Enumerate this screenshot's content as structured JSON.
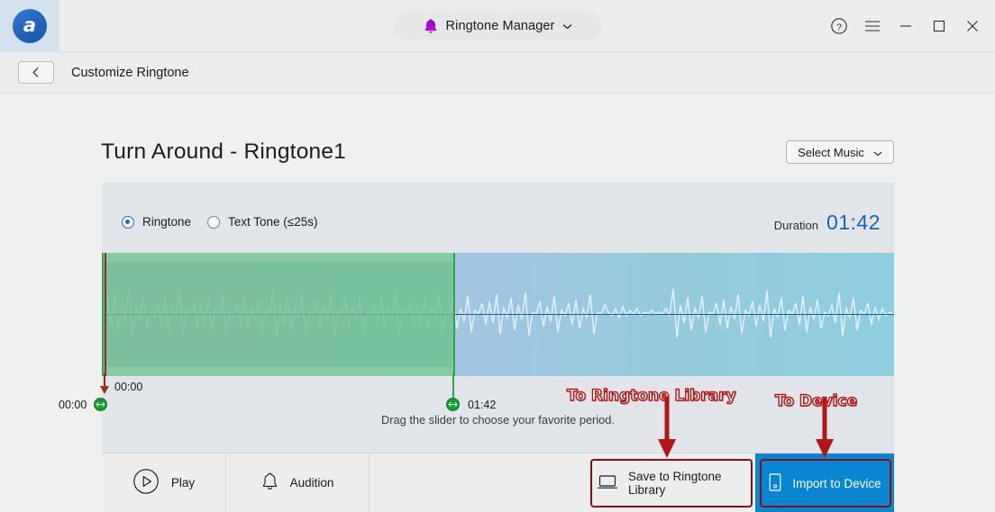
{
  "titlebar": {
    "logo_glyph": "a",
    "app_switcher": {
      "label": "Ringtone Manager",
      "icon": "bell-icon",
      "chevron": "chevron-down-icon"
    },
    "controls": [
      {
        "name": "help-icon",
        "glyph": "?"
      },
      {
        "name": "menu-icon",
        "glyph": "☰"
      },
      {
        "name": "minimize-icon",
        "glyph": "–"
      },
      {
        "name": "maximize-icon",
        "glyph": "☐"
      },
      {
        "name": "close-icon",
        "glyph": "✕"
      }
    ]
  },
  "breadcrumb": {
    "back_glyph": "‹",
    "title": "Customize Ringtone"
  },
  "header": {
    "page_title": "Turn Around - Ringtone1",
    "select_music_label": "Select Music",
    "select_music_chevron": "chevron-down-icon"
  },
  "editor": {
    "options": [
      {
        "label": "Ringtone",
        "selected": true
      },
      {
        "label": "Text Tone (≤25s)",
        "selected": false
      }
    ],
    "duration_label": "Duration",
    "duration_value": "01:42",
    "outside_start_time": "00:00",
    "start_time": "00:00",
    "end_time": "01:42",
    "hint": "Drag the slider to choose your favorite period.",
    "selection": {
      "start_pct": 0,
      "end_pct": 44.6
    }
  },
  "actions": {
    "play": {
      "label": "Play",
      "icon": "play-circle-icon"
    },
    "audition": {
      "label": "Audition",
      "icon": "bell-outline-icon"
    },
    "save": {
      "label": "Save to Ringtone Library",
      "icon": "laptop-icon"
    },
    "import": {
      "label": "Import to Device",
      "icon": "phone-icon"
    }
  },
  "annotations": [
    {
      "text": "To Ringtone Library",
      "target": "save-to-ringtone-library-button"
    },
    {
      "text": "To Device",
      "target": "import-to-device-button"
    }
  ],
  "colors": {
    "accent_blue": "#0a85d1",
    "duration_blue": "#1565c0",
    "selection_green": "#2fa54f",
    "annotation_red": "#b31515",
    "annotation_box": "#8a0f13"
  }
}
